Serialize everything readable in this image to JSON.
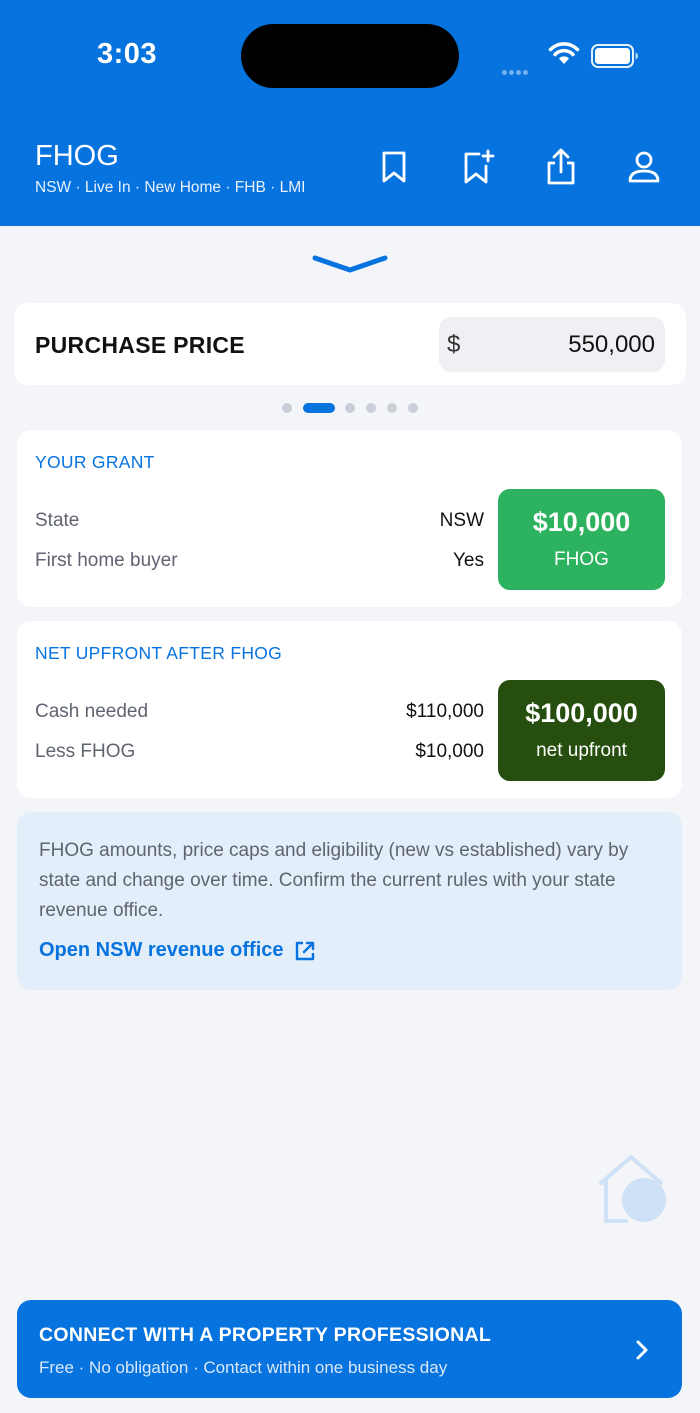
{
  "status_bar": {
    "time": "3:03"
  },
  "header": {
    "title": "FHOG",
    "subtitle": "NSW · Live In · New Home · FHB · LMI",
    "icons": [
      "bookmark-icon",
      "bookmark-add-icon",
      "share-icon",
      "account-icon"
    ]
  },
  "purchase": {
    "label": "PURCHASE PRICE",
    "currency": "$",
    "value": "550,000"
  },
  "pager": {
    "count": 6,
    "active_index": 1
  },
  "grant": {
    "title": "YOUR GRANT",
    "rows": [
      {
        "label": "State",
        "value": "NSW"
      },
      {
        "label": "First home buyer",
        "value": "Yes"
      }
    ],
    "badge_amount": "$10,000",
    "badge_caption": "FHOG",
    "badge_color": "#2db35f"
  },
  "net": {
    "title": "NET UPFRONT AFTER FHOG",
    "rows": [
      {
        "label": "Cash needed",
        "value": "$110,000"
      },
      {
        "label": "Less FHOG",
        "value": "$10,000"
      }
    ],
    "badge_amount": "$100,000",
    "badge_caption": "net upfront",
    "badge_color": "#264f0f"
  },
  "info": {
    "text": "FHOG amounts, price caps and eligibility (new vs established) vary by state and change over time. Confirm the current rules with your state revenue office.",
    "link_label": "Open NSW revenue office"
  },
  "cta": {
    "title": "CONNECT WITH A PROPERTY PROFESSIONAL",
    "subtitle": "Free · No obligation · Contact within one business day"
  },
  "colors": {
    "primary": "#0673de",
    "background": "#f3f5f9"
  }
}
